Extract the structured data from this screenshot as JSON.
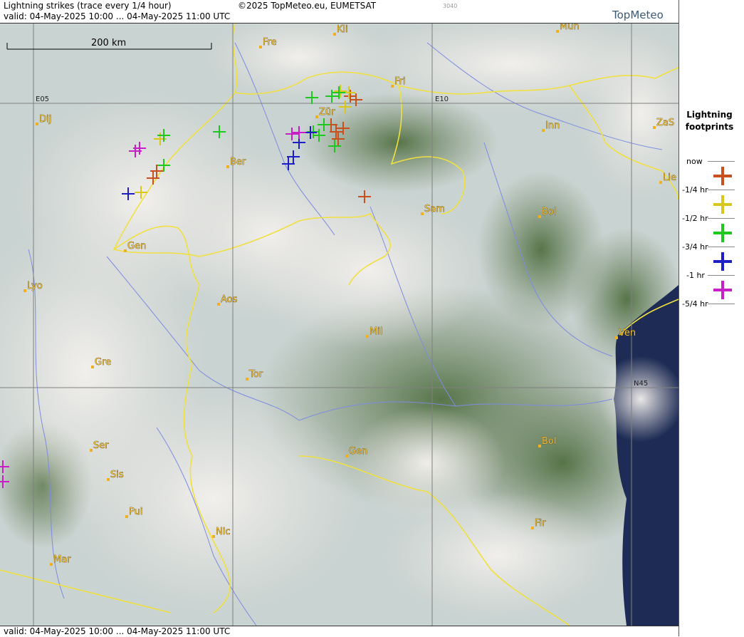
{
  "header": {
    "title": "Lightning strikes (trace every 1/4 hour)",
    "copyright": "©2025 TopMeteo.eu, EUMETSAT",
    "code": "3040",
    "valid": "valid:  04-May-2025 10:00 ... 04-May-2025 11:00 UTC",
    "brand": "TopMeteo"
  },
  "scale_bar": {
    "label": "200 km"
  },
  "grid_labels": [
    "E05",
    "E10",
    "N45"
  ],
  "cities": [
    "Kli",
    "Mun",
    "Fre",
    "Fri",
    "Dij",
    "Zür",
    "Inn",
    "ZaS",
    "Ber",
    "Lie",
    "Sam",
    "Bol",
    "Gen",
    "Lyo",
    "Aos",
    "Mil",
    "Ven",
    "Gre",
    "Tor",
    "Ser",
    "Gen",
    "Bol",
    "Sis",
    "Pui",
    "Nic",
    "Fir",
    "Mar"
  ],
  "legend": {
    "title_line1": "Lightning",
    "title_line2": "footprints",
    "levels": [
      {
        "label": "now",
        "color": "#c8501e"
      },
      {
        "label": "-1/4 hr",
        "color": "#d8c81e"
      },
      {
        "label": "-1/2 hr",
        "color": "#1ec81e"
      },
      {
        "label": "-3/4 hr",
        "color": "#1e1ec8"
      },
      {
        "label": "-1 hr",
        "color": "#c81ec8"
      },
      {
        "label": "-5/4 hr",
        "color": ""
      }
    ]
  },
  "footer": {
    "valid": "valid:  04-May-2025 10:00 ... 04-May-2025 11:00 UTC"
  }
}
